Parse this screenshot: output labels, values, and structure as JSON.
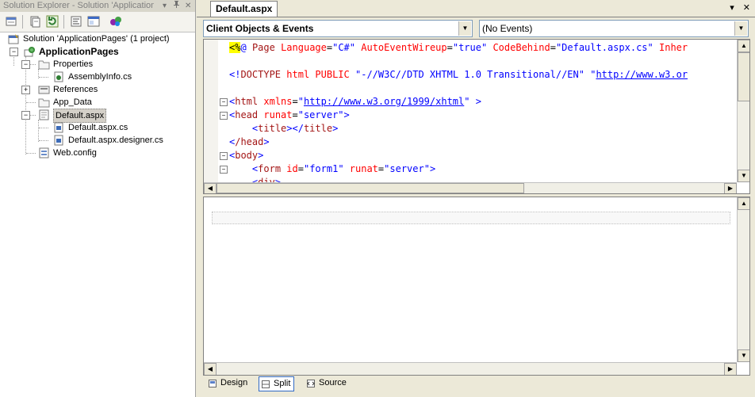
{
  "solution_explorer": {
    "title": "Solution Explorer - Solution 'Application...",
    "controls": {
      "dropdown": "▾",
      "pin": "📌",
      "close": "✕"
    },
    "toolbar": [
      "properties-icon",
      "show-all-files-icon",
      "refresh-icon",
      "view-code-icon",
      "view-designer-icon",
      "copy-website-icon"
    ],
    "tree": {
      "solution": "Solution 'ApplicationPages' (1 project)",
      "project": "ApplicationPages",
      "properties": "Properties",
      "assemblyinfo": "AssemblyInfo.cs",
      "references": "References",
      "app_data": "App_Data",
      "default_aspx": "Default.aspx",
      "default_cs": "Default.aspx.cs",
      "default_designer": "Default.aspx.designer.cs",
      "webconfig": "Web.config"
    }
  },
  "document": {
    "tab": "Default.aspx",
    "tab_controls": {
      "dropdown": "▾",
      "close": "✕"
    },
    "object_dropdown": "Client Objects & Events",
    "event_dropdown": "(No Events)",
    "code": {
      "l1_open": "<",
      "l1_pct": "%",
      "l1_at": "@",
      "l1_dir": "Page",
      "l1_a1": "Language",
      "l1_v1": "\"C#\"",
      "l1_a2": "AutoEventWireup",
      "l1_v2": "\"true\"",
      "l1_a3": "CodeBehind",
      "l1_v3": "\"Default.aspx.cs\"",
      "l1_a4": "Inher",
      "l2_open": "<!",
      "l2_doctype": "DOCTYPE",
      "l2_html": "html",
      "l2_public": "PUBLIC",
      "l2_str1": "\"-//W3C//DTD XHTML 1.0 Transitional//EN\"",
      "l2_q": "\"",
      "l2_link": "http://www.w3.or",
      "l3_tag": "html",
      "l3_attr": "xmlns",
      "l3_link": "http://www.w3.org/1999/xhtml",
      "l4_tag": "head",
      "l4_attr": "runat",
      "l4_val": "\"server\"",
      "l5_tag": "title",
      "l6_tag": "/head",
      "l7_tag": "body",
      "l8_tag": "form",
      "l8_attr1": "id",
      "l8_val1": "\"form1\"",
      "l8_attr2": "runat",
      "l8_val2": "\"server\"",
      "l9_tag": "div"
    },
    "view_buttons": {
      "design": "Design",
      "split": "Split",
      "source": "Source"
    }
  }
}
